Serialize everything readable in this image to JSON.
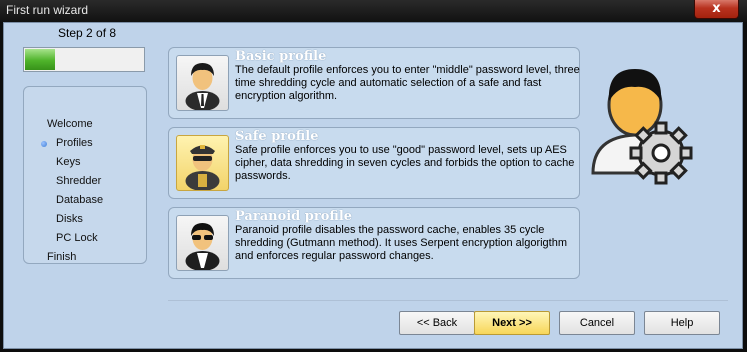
{
  "window": {
    "title": "First run wizard",
    "close_glyph": "x"
  },
  "wizard": {
    "step_label": "Step 2 of 8",
    "progress": 0.25,
    "colors": {
      "progress_fill": "#4fb42b",
      "client_bg": "#bfd3ea",
      "selected_card": "#f7d659"
    }
  },
  "steps": [
    {
      "label": "Welcome",
      "sub": false,
      "current": false
    },
    {
      "label": "Profiles",
      "sub": true,
      "current": true
    },
    {
      "label": "Keys",
      "sub": true,
      "current": false
    },
    {
      "label": "Shredder",
      "sub": true,
      "current": false
    },
    {
      "label": "Database",
      "sub": true,
      "current": false
    },
    {
      "label": "Disks",
      "sub": true,
      "current": false
    },
    {
      "label": "PC Lock",
      "sub": true,
      "current": false
    },
    {
      "label": "Finish",
      "sub": false,
      "current": false
    }
  ],
  "profiles": [
    {
      "title": "Basic profile",
      "description": "The default profile enforces you to enter \"middle\" password level, three time shredding cycle and automatic selection of a safe and fast encryption algorithm.",
      "icon": "user-icon",
      "selected": false
    },
    {
      "title": "Safe profile",
      "description": "Safe profile enforces you to use \"good\" password level, sets up AES cipher, data shredding in seven cycles and forbids the option to cache passwords.",
      "icon": "officer-icon",
      "selected": true
    },
    {
      "title": "Paranoid profile",
      "description": "Paranoid profile disables the password cache, enables 35 cycle shredding (Gutmann method). It uses Serpent encryption algorigthm and enforces regular password changes.",
      "icon": "agent-icon",
      "selected": false
    }
  ],
  "buttons": {
    "back": "<< Back",
    "next": "Next >>",
    "cancel": "Cancel",
    "help": "Help"
  },
  "decor": {
    "big_icon": "user-settings-icon"
  }
}
